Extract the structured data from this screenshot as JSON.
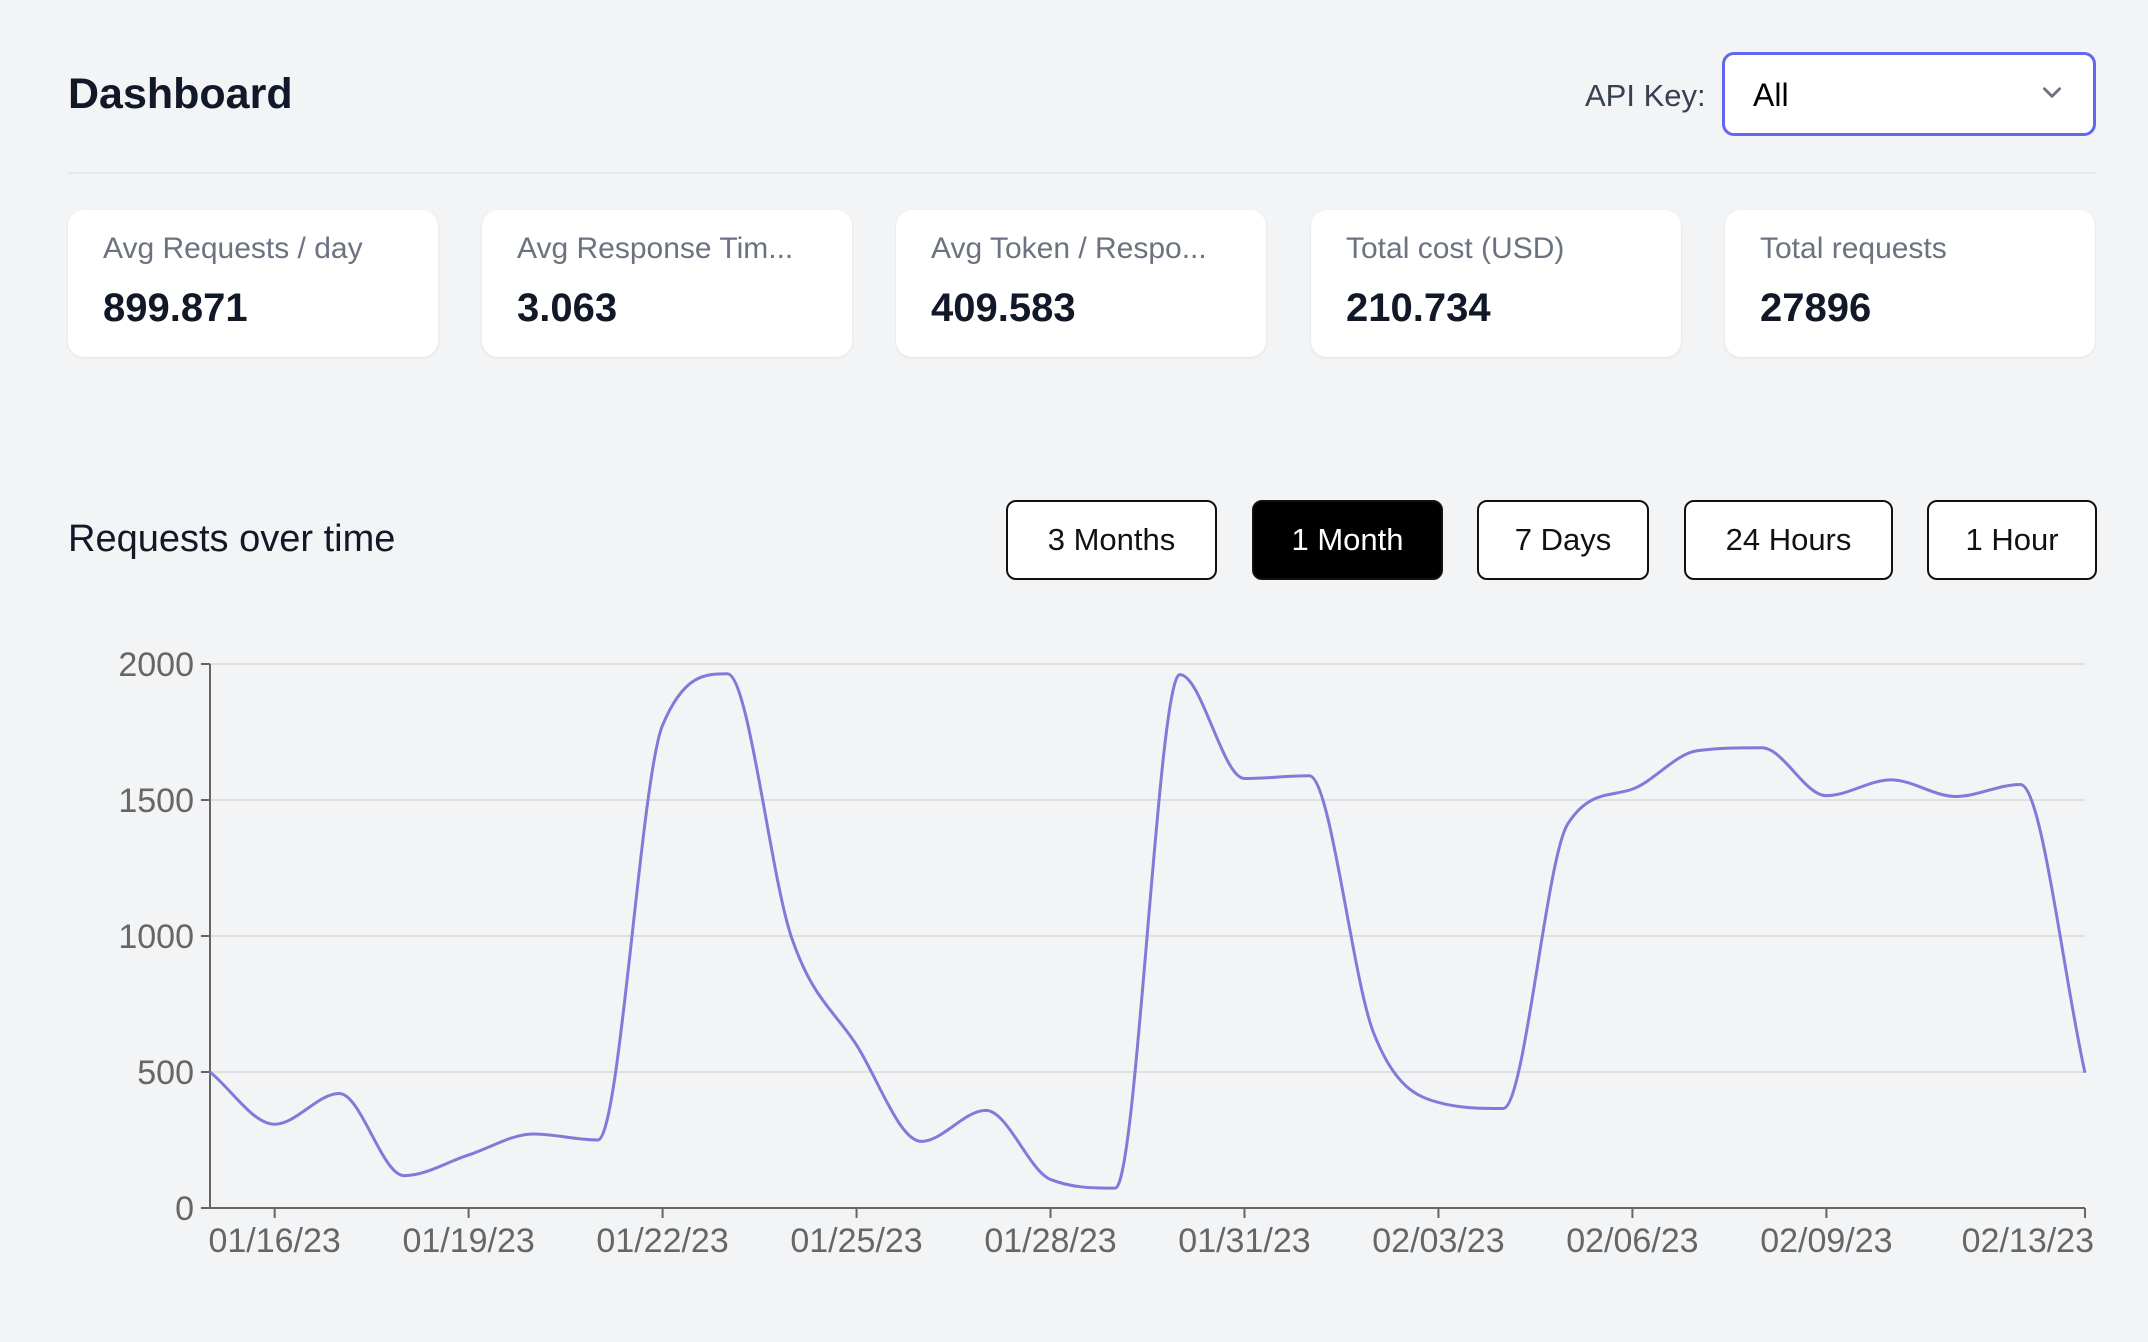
{
  "header": {
    "title": "Dashboard",
    "api_key_label": "API Key:",
    "api_key_value": "All",
    "accent_color": "#6366f1"
  },
  "stats": [
    {
      "label": "Avg Requests / day",
      "value": "899.871"
    },
    {
      "label": "Avg Response Tim...",
      "value": "3.063"
    },
    {
      "label": "Avg Token / Respo...",
      "value": "409.583"
    },
    {
      "label": "Total cost (USD)",
      "value": "210.734"
    },
    {
      "label": "Total requests",
      "value": "27896"
    }
  ],
  "section": {
    "title": "Requests over time",
    "ranges": [
      {
        "label": "3 Months",
        "active": false
      },
      {
        "label": "1 Month",
        "active": true
      },
      {
        "label": "7 Days",
        "active": false
      },
      {
        "label": "24 Hours",
        "active": false
      },
      {
        "label": "1 Hour",
        "active": false
      }
    ]
  },
  "chart_data": {
    "type": "line",
    "line_color": "#8479d9",
    "grid": true,
    "ylim": [
      0,
      2000
    ],
    "y_ticks": [
      "0",
      "500",
      "1000",
      "1500",
      "2000"
    ],
    "x_range": [
      "2023-01-15",
      "2023-02-13"
    ],
    "x_ticks": [
      {
        "date": "2023-01-16",
        "label": "01/16/23"
      },
      {
        "date": "2023-01-19",
        "label": "01/19/23"
      },
      {
        "date": "2023-01-22",
        "label": "01/22/23"
      },
      {
        "date": "2023-01-25",
        "label": "01/25/23"
      },
      {
        "date": "2023-01-28",
        "label": "01/28/23"
      },
      {
        "date": "2023-01-31",
        "label": "01/31/23"
      },
      {
        "date": "2023-02-03",
        "label": "02/03/23"
      },
      {
        "date": "2023-02-06",
        "label": "02/06/23"
      },
      {
        "date": "2023-02-09",
        "label": "02/09/23"
      },
      {
        "date": "2023-02-13",
        "label": "02/13/23"
      }
    ],
    "x": [
      "2023-01-15",
      "2023-01-16",
      "2023-01-17",
      "2023-01-18",
      "2023-01-19",
      "2023-01-20",
      "2023-01-21",
      "2023-01-22",
      "2023-01-23",
      "2023-01-24",
      "2023-01-25",
      "2023-01-26",
      "2023-01-27",
      "2023-01-28",
      "2023-01-29",
      "2023-01-30",
      "2023-01-31",
      "2023-02-01",
      "2023-02-02",
      "2023-02-03",
      "2023-02-04",
      "2023-02-05",
      "2023-02-06",
      "2023-02-07",
      "2023-02-08",
      "2023-02-09",
      "2023-02-10",
      "2023-02-11",
      "2023-02-12",
      "2023-02-13"
    ],
    "values": [
      500,
      308,
      421,
      119,
      195,
      272,
      250,
      1775,
      1964,
      991,
      599,
      245,
      359,
      105,
      73,
      1961,
      1579,
      1589,
      642,
      388,
      366,
      1412,
      1540,
      1681,
      1692,
      1516,
      1574,
      1513,
      1557,
      497
    ]
  }
}
